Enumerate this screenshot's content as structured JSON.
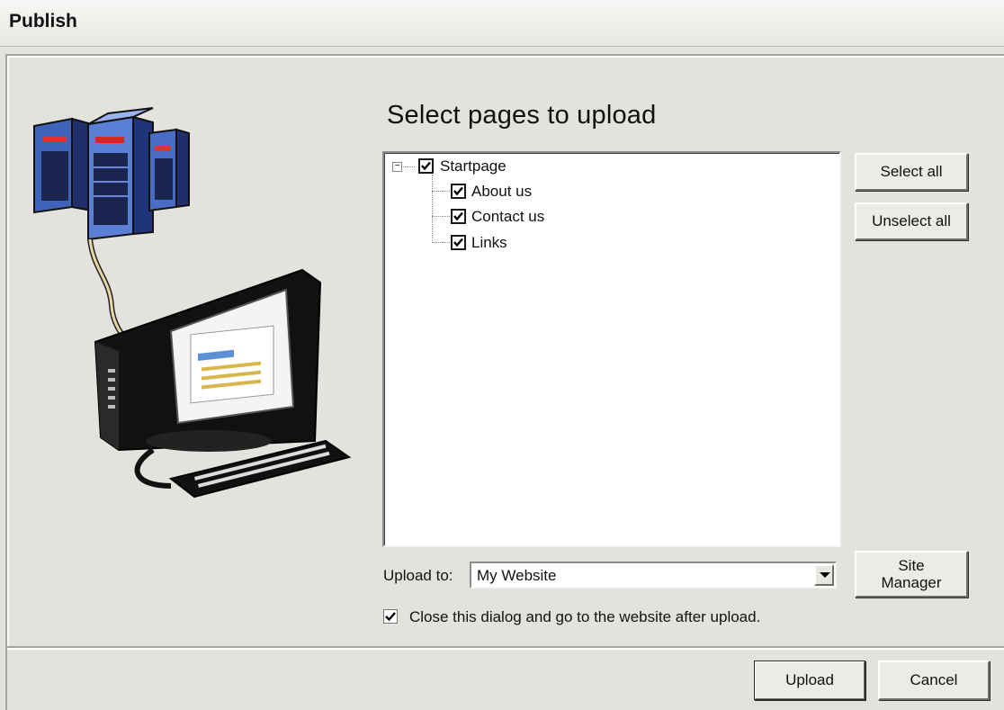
{
  "window": {
    "title": "Publish"
  },
  "illustration": {
    "icon": "server-to-computer-illustration"
  },
  "main": {
    "heading": "Select pages to upload",
    "tree": {
      "root": {
        "label": "Startpage",
        "checked": true,
        "expanded": true,
        "expander_glyph": "−"
      },
      "children": [
        {
          "label": "About us",
          "checked": true
        },
        {
          "label": "Contact us",
          "checked": true
        },
        {
          "label": "Links",
          "checked": true
        }
      ]
    },
    "select_all_label": "Select all",
    "unselect_all_label": "Unselect all",
    "upload_to": {
      "label": "Upload to:",
      "value": "My Website"
    },
    "site_manager": {
      "line1": "Site",
      "line2": "Manager"
    },
    "close_after_upload": {
      "label": "Close this dialog and go to the website after upload.",
      "checked": true
    }
  },
  "footer": {
    "upload_label": "Upload",
    "cancel_label": "Cancel"
  }
}
